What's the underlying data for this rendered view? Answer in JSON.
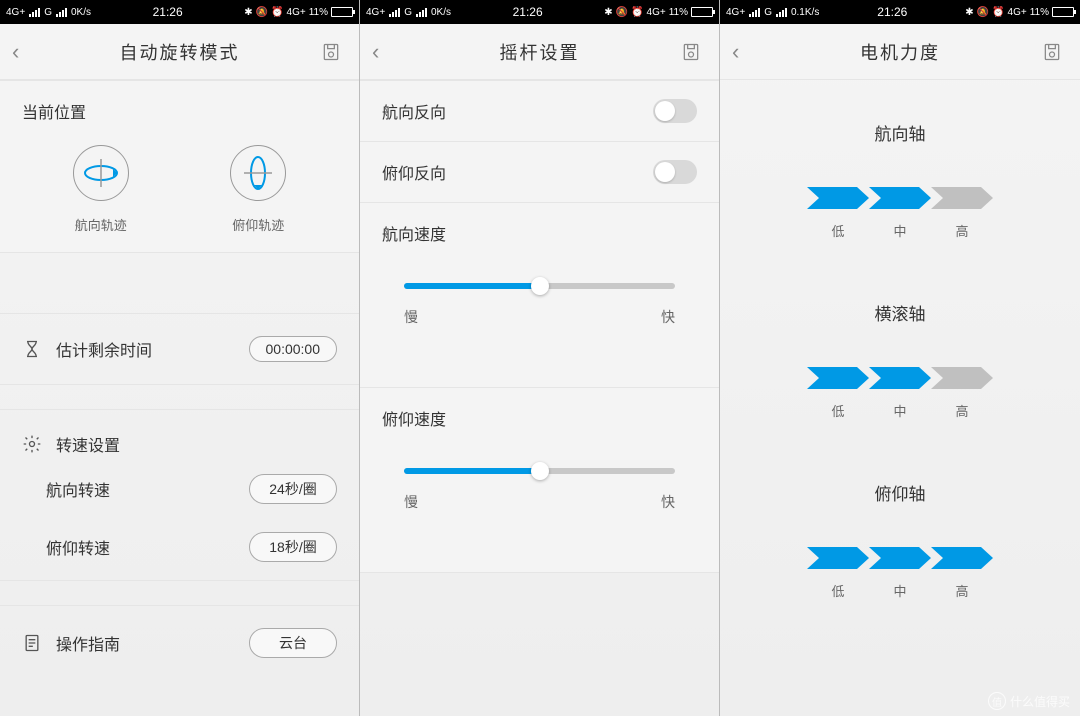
{
  "statusbar": {
    "net1": "4G+",
    "net2": "G",
    "speed_a": "0K/s",
    "speed_c": "0.1K/s",
    "time": "21:26",
    "bt": "✻",
    "alarm": "⏰",
    "4g": "4G+",
    "batt": "11%"
  },
  "screen1": {
    "title": "自动旋转模式",
    "current_pos": "当前位置",
    "traj_yaw": "航向轨迹",
    "traj_pitch": "俯仰轨迹",
    "est_time_label": "估计剩余时间",
    "est_time_value": "00:00:00",
    "speed_setting": "转速设置",
    "yaw_speed_label": "航向转速",
    "yaw_speed_value": "24秒/圈",
    "pitch_speed_label": "俯仰转速",
    "pitch_speed_value": "18秒/圈",
    "guide": "操作指南",
    "gimbal": "云台"
  },
  "screen2": {
    "title": "摇杆设置",
    "yaw_reverse": "航向反向",
    "pitch_reverse": "俯仰反向",
    "yaw_speed": "航向速度",
    "pitch_speed": "俯仰速度",
    "slow": "慢",
    "fast": "快"
  },
  "screen3": {
    "title": "电机力度",
    "yaw_axis": "航向轴",
    "roll_axis": "横滚轴",
    "pitch_axis": "俯仰轴",
    "low": "低",
    "mid": "中",
    "high": "高",
    "yaw_level": 2,
    "roll_level": 2,
    "pitch_level": 3
  },
  "watermark": "什么值得买"
}
